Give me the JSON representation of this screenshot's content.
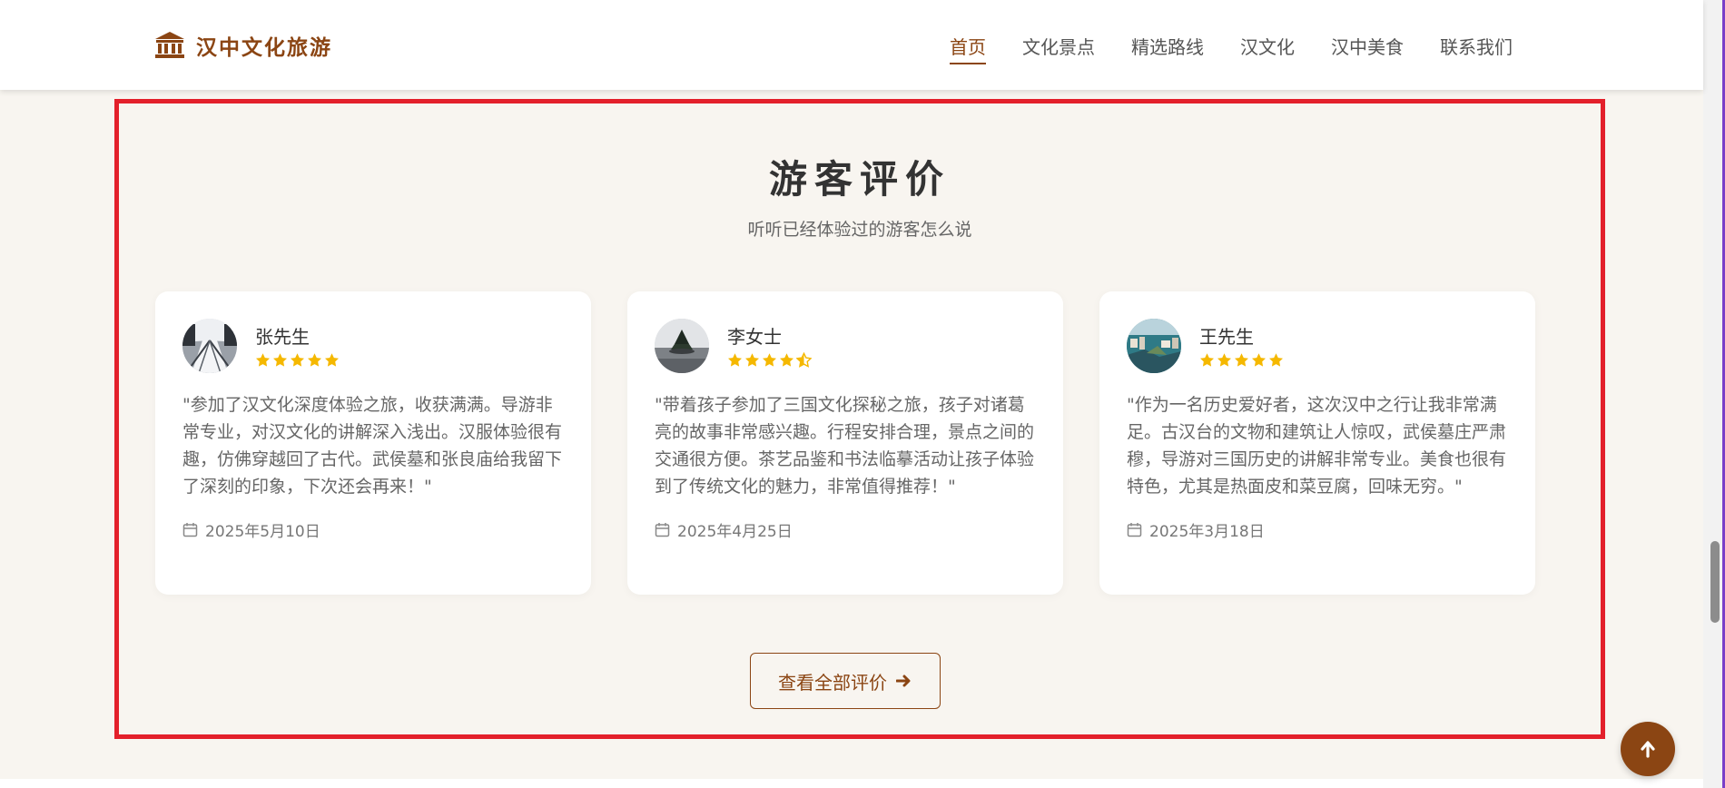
{
  "header": {
    "logo_icon": "museum-icon",
    "logo_text": "汉中文化旅游",
    "nav": [
      {
        "label": "首页",
        "active": true
      },
      {
        "label": "文化景点",
        "active": false
      },
      {
        "label": "精选路线",
        "active": false
      },
      {
        "label": "汉文化",
        "active": false
      },
      {
        "label": "汉中美食",
        "active": false
      },
      {
        "label": "联系我们",
        "active": false
      }
    ]
  },
  "testimonials": {
    "title": "游客评价",
    "subtitle": "听听已经体验过的游客怎么说",
    "reviews": [
      {
        "name": "张先生",
        "rating": 5,
        "text": "\"参加了汉文化深度体验之旅，收获满满。导游非常专业，对汉文化的讲解深入浅出。汉服体验很有趣，仿佛穿越回了古代。武侯墓和张良庙给我留下了深刻的印象，下次还会再来！\"",
        "date": "2025年5月10日",
        "avatar": "building-corridor-photo"
      },
      {
        "name": "李女士",
        "rating": 4.5,
        "text": "\"带着孩子参加了三国文化探秘之旅，孩子对诸葛亮的故事非常感兴趣。行程安排合理，景点之间的交通很方便。茶艺品鉴和书法临摹活动让孩子体验到了传统文化的魅力，非常值得推荐！\"",
        "date": "2025年4月25日",
        "avatar": "island-tree-photo"
      },
      {
        "name": "王先生",
        "rating": 5,
        "text": "\"作为一名历史爱好者，这次汉中之行让我非常满足。古汉台的文物和建筑让人惊叹，武侯墓庄严肃穆，导游对三国历史的讲解非常专业。美食也很有特色，尤其是热面皮和菜豆腐，回味无穷。\"",
        "date": "2025年3月18日",
        "avatar": "coastal-city-photo"
      }
    ],
    "view_all_label": "查看全部评价"
  },
  "colors": {
    "brand": "#8b4513",
    "star": "#f5b800",
    "highlight_border": "#e3202b",
    "background": "#f8f5f0"
  }
}
